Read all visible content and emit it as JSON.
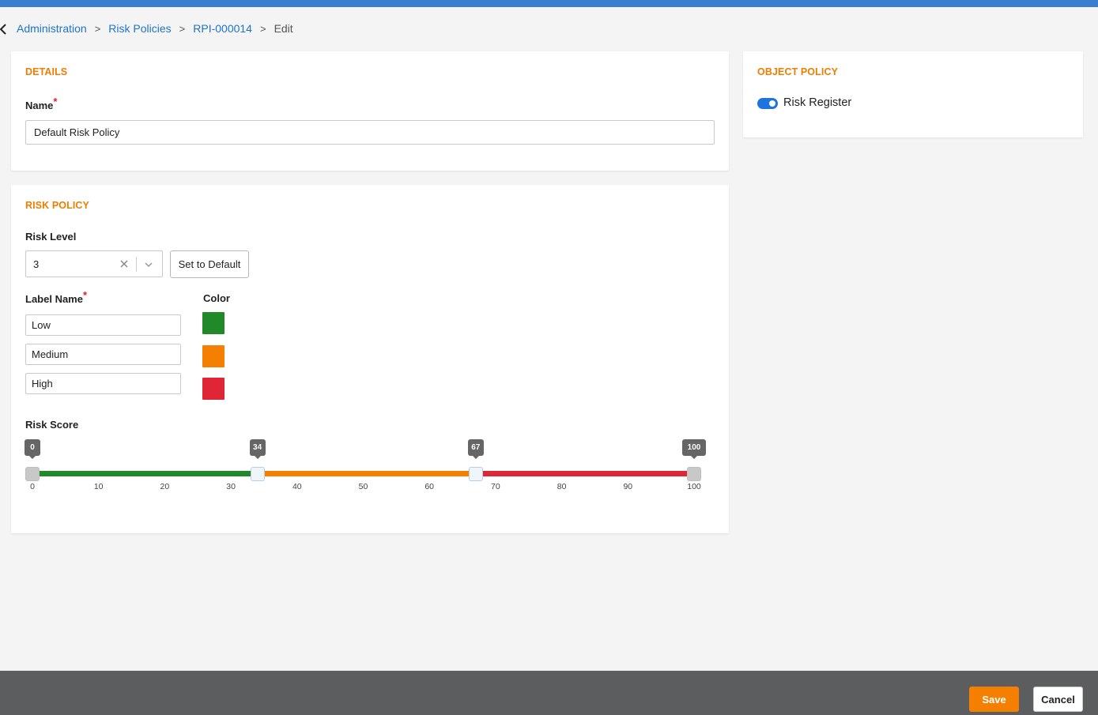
{
  "breadcrumb": {
    "items": [
      "Administration",
      "Risk Policies",
      "RPI-000014"
    ],
    "current": "Edit",
    "separator": ">"
  },
  "details": {
    "title": "DETAILS",
    "name_label": "Name",
    "required_mark": "*",
    "name_value": "Default Risk Policy"
  },
  "risk_policy": {
    "title": "RISK POLICY",
    "risk_level_label": "Risk Level",
    "risk_level_value": "3",
    "set_default_label": "Set to Default",
    "label_name_header": "Label Name",
    "required_mark": "*",
    "color_header": "Color",
    "levels": [
      {
        "label": "Low",
        "color": "#22892b"
      },
      {
        "label": "Medium",
        "color": "#f57f00"
      },
      {
        "label": "High",
        "color": "#de2637"
      }
    ],
    "risk_score_label": "Risk Score",
    "score": {
      "min": 0,
      "max": 100,
      "thresholds": [
        34,
        67
      ],
      "badges": [
        "0",
        "34",
        "67",
        "100"
      ],
      "ticks": [
        "0",
        "10",
        "20",
        "30",
        "40",
        "50",
        "60",
        "70",
        "80",
        "90",
        "100"
      ]
    }
  },
  "object_policy": {
    "title": "OBJECT POLICY",
    "toggle_label": "Risk Register",
    "toggle_on": true
  },
  "footer": {
    "save_label": "Save",
    "cancel_label": "Cancel"
  },
  "colors": {
    "accent_orange": "#f07c00",
    "link_blue": "#1f73c9",
    "topbar_blue": "#3a7fcf",
    "footer_gray": "#5c5d5e"
  }
}
